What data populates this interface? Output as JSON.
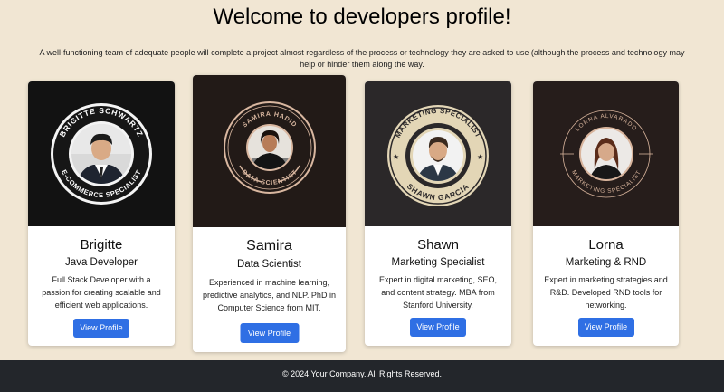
{
  "page": {
    "title": "Welcome to developers profile!",
    "intro": "A well-functioning team of adequate people will complete a project almost regardless of the process or technology they are asked to use (although the process and technology may help or hinder them along the way."
  },
  "cards": [
    {
      "name": "Brigitte",
      "role": "Java Developer",
      "description": "Full Stack Developer with a passion for creating scalable and efficient web applications.",
      "badge_top": "BRIGITTE SCHWARTZ",
      "badge_bottom": "E-COMMERCE SPECIALIST",
      "button": "View Profile"
    },
    {
      "name": "Samira",
      "role": "Data Scientist",
      "description": "Experienced in machine learning, predictive analytics, and NLP. PhD in Computer Science from MIT.",
      "badge_top": "SAMIRA HADID",
      "badge_bottom": "DATA SCIENTIST",
      "button": "View Profile"
    },
    {
      "name": "Shawn",
      "role": "Marketing Specialist",
      "description": "Expert in digital marketing, SEO, and content strategy. MBA from Stanford University.",
      "badge_top": "MARKETING SPECIALIST",
      "badge_bottom": "SHAWN GARCIA",
      "button": "View Profile"
    },
    {
      "name": "Lorna",
      "role": "Marketing & RND",
      "description": "Expert in marketing strategies and R&D. Developed RND tools for networking.",
      "badge_top": "LORNA ALVARADO",
      "badge_bottom": "MARKETING SPECIALIST",
      "button": "View Profile"
    }
  ],
  "footer": {
    "text": "© 2024 Your Company. All Rights Reserved."
  },
  "colors": {
    "background": "#f1e6d3",
    "button": "#2f6fe4",
    "footer": "#23262b"
  }
}
